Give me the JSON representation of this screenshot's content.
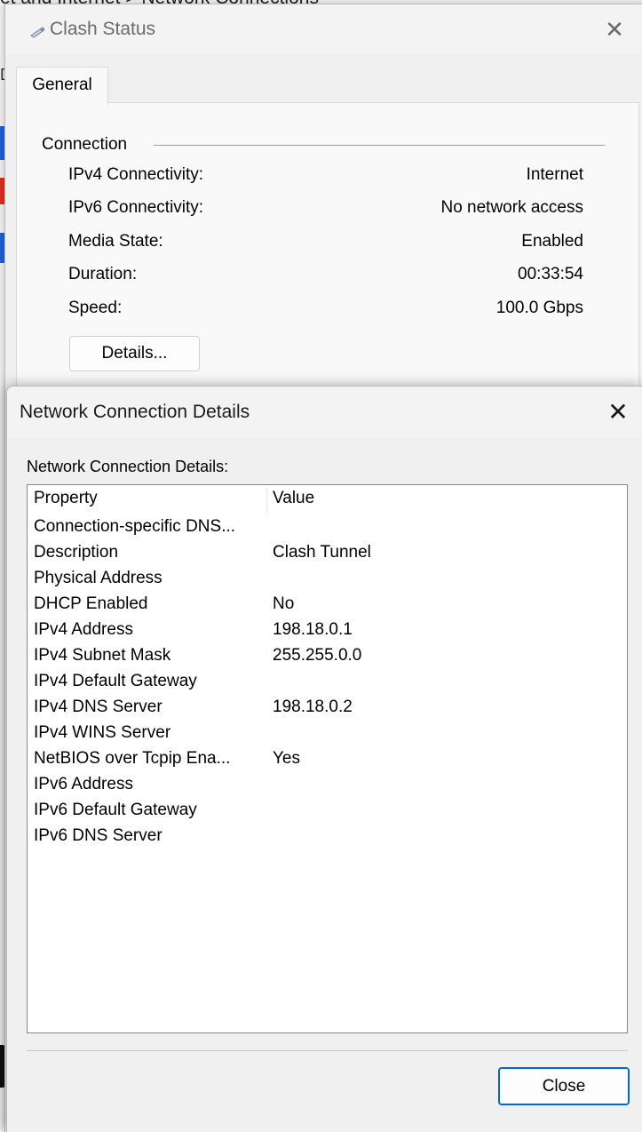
{
  "background": {
    "title_partial": "et and Internet > Network Connections",
    "label_partial": "D"
  },
  "status_dialog": {
    "title": "Clash Status",
    "close_glyph": "✕",
    "tab": "General",
    "group": "Connection",
    "rows": [
      {
        "label": "IPv4 Connectivity:",
        "value": "Internet"
      },
      {
        "label": "IPv6 Connectivity:",
        "value": "No network access"
      },
      {
        "label": "Media State:",
        "value": "Enabled"
      },
      {
        "label": "Duration:",
        "value": "00:33:54"
      },
      {
        "label": "Speed:",
        "value": "100.0 Gbps"
      }
    ],
    "details_button": "Details..."
  },
  "details_dialog": {
    "title": "Network Connection Details",
    "close_glyph": "✕",
    "caption": "Network Connection Details:",
    "columns": {
      "property": "Property",
      "value": "Value"
    },
    "rows": [
      {
        "property": "Connection-specific DNS...",
        "value": ""
      },
      {
        "property": "Description",
        "value": "Clash Tunnel"
      },
      {
        "property": "Physical Address",
        "value": ""
      },
      {
        "property": "DHCP Enabled",
        "value": "No"
      },
      {
        "property": "IPv4 Address",
        "value": "198.18.0.1"
      },
      {
        "property": "IPv4 Subnet Mask",
        "value": "255.255.0.0"
      },
      {
        "property": "IPv4 Default Gateway",
        "value": ""
      },
      {
        "property": "IPv4 DNS Server",
        "value": "198.18.0.2"
      },
      {
        "property": "IPv4 WINS Server",
        "value": ""
      },
      {
        "property": "NetBIOS over Tcpip Ena...",
        "value": "Yes"
      },
      {
        "property": "IPv6 Address",
        "value": ""
      },
      {
        "property": "IPv6 Default Gateway",
        "value": ""
      },
      {
        "property": "IPv6 DNS Server",
        "value": ""
      }
    ],
    "close_button": "Close"
  },
  "colors": {
    "accent_border": "#0067c0",
    "strip_blue": "#1f5fd6",
    "strip_red": "#d93025"
  },
  "icons": {
    "status_title": "network-cable-icon",
    "close": "close-icon"
  }
}
